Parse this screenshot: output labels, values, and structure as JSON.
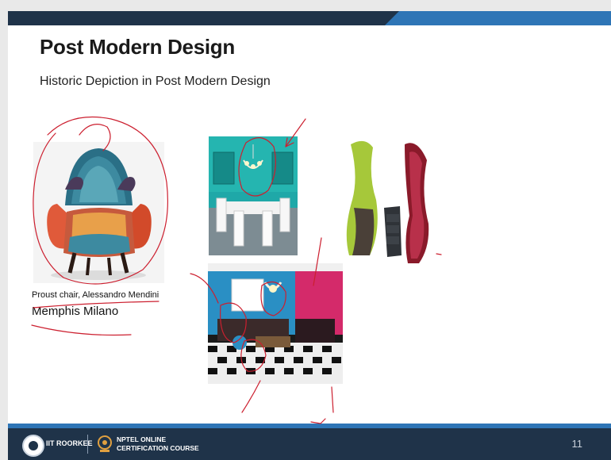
{
  "slide": {
    "title": "Post Modern Design",
    "subtitle": "Historic Depiction in Post Modern Design",
    "page_number": "11"
  },
  "images": {
    "chair_caption": "Proust chair, Alessandro Mendini",
    "chair_caption2": "Memphis Milano"
  },
  "footer": {
    "iit": "IIT ROORKEE",
    "nptel_line1": "NPTEL ONLINE",
    "nptel_line2": "CERTIFICATION COURSE"
  },
  "colors": {
    "navy": "#1f3349",
    "accent_blue": "#2e75b6",
    "annotation_red": "#cc1f2f"
  }
}
